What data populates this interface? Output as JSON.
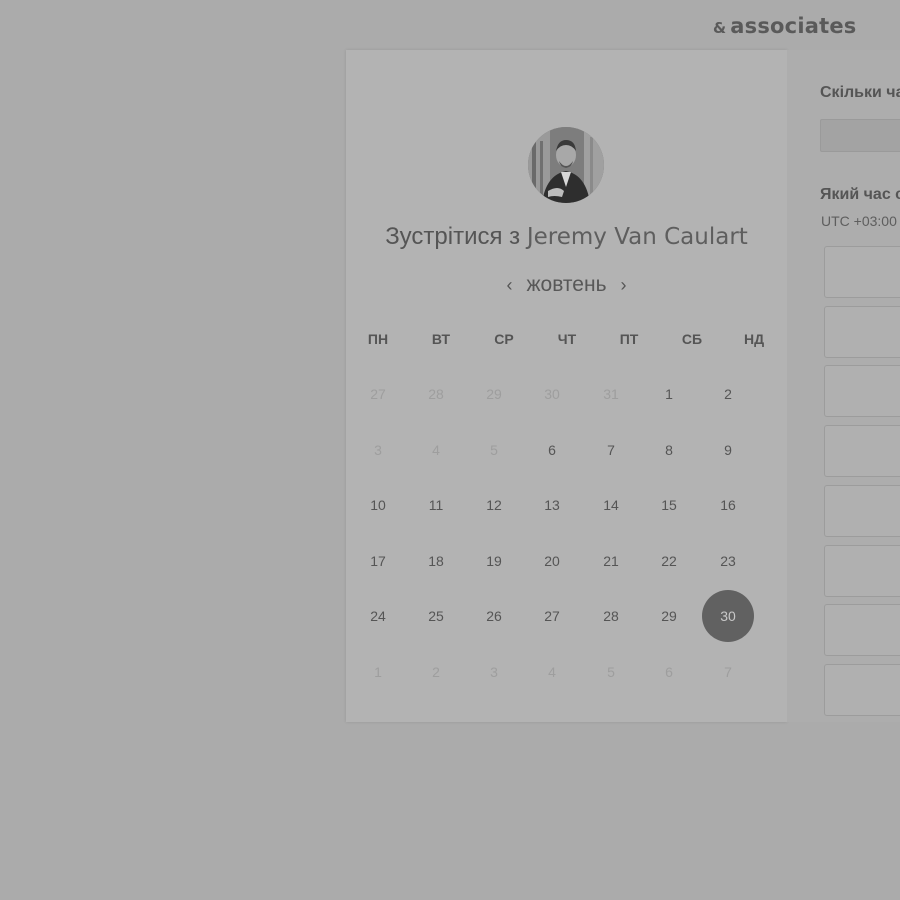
{
  "brand": {
    "amp": "&",
    "name": "associates"
  },
  "booking": {
    "title_prefix": "Зустрітися з",
    "host_name": "Jeremy Van Caulart",
    "avatar_icon": "person-photo",
    "month": "жовтень",
    "prev_icon": "chevron-left-icon",
    "next_icon": "chevron-right-icon",
    "prev_glyph": "‹",
    "next_glyph": "›",
    "weekdays": [
      "ПН",
      "ВТ",
      "СР",
      "ЧТ",
      "ПТ",
      "СБ",
      "НД"
    ],
    "weeks": [
      [
        {
          "d": "27",
          "m": true
        },
        {
          "d": "28",
          "m": true
        },
        {
          "d": "29",
          "m": true
        },
        {
          "d": "30",
          "m": true
        },
        {
          "d": "31",
          "m": true
        },
        {
          "d": "1",
          "m": false
        },
        {
          "d": "2",
          "m": false
        }
      ],
      [
        {
          "d": "3",
          "m": true
        },
        {
          "d": "4",
          "m": true
        },
        {
          "d": "5",
          "m": true
        },
        {
          "d": "6",
          "m": false
        },
        {
          "d": "7",
          "m": false
        },
        {
          "d": "8",
          "m": false
        },
        {
          "d": "9",
          "m": false
        }
      ],
      [
        {
          "d": "10",
          "m": false
        },
        {
          "d": "11",
          "m": false
        },
        {
          "d": "12",
          "m": false
        },
        {
          "d": "13",
          "m": false
        },
        {
          "d": "14",
          "m": false
        },
        {
          "d": "15",
          "m": false
        },
        {
          "d": "16",
          "m": false
        }
      ],
      [
        {
          "d": "17",
          "m": false
        },
        {
          "d": "18",
          "m": false
        },
        {
          "d": "19",
          "m": false
        },
        {
          "d": "20",
          "m": false
        },
        {
          "d": "21",
          "m": false
        },
        {
          "d": "22",
          "m": false
        },
        {
          "d": "23",
          "m": false
        }
      ],
      [
        {
          "d": "24",
          "m": false
        },
        {
          "d": "25",
          "m": false
        },
        {
          "d": "26",
          "m": false
        },
        {
          "d": "27",
          "m": false
        },
        {
          "d": "28",
          "m": false
        },
        {
          "d": "29",
          "m": false
        },
        {
          "d": "30",
          "m": false,
          "selected": true
        }
      ],
      [
        {
          "d": "1",
          "m": true
        },
        {
          "d": "2",
          "m": true
        },
        {
          "d": "3",
          "m": true
        },
        {
          "d": "4",
          "m": true
        },
        {
          "d": "5",
          "m": true
        },
        {
          "d": "6",
          "m": true
        },
        {
          "d": "7",
          "m": true
        }
      ]
    ]
  },
  "right_panel": {
    "duration_label": "Скільки ча",
    "time_label": "Який час с",
    "timezone": "UTC +03:00"
  },
  "colors": {
    "overlay": "#ababab",
    "selected_day": "#616161"
  }
}
